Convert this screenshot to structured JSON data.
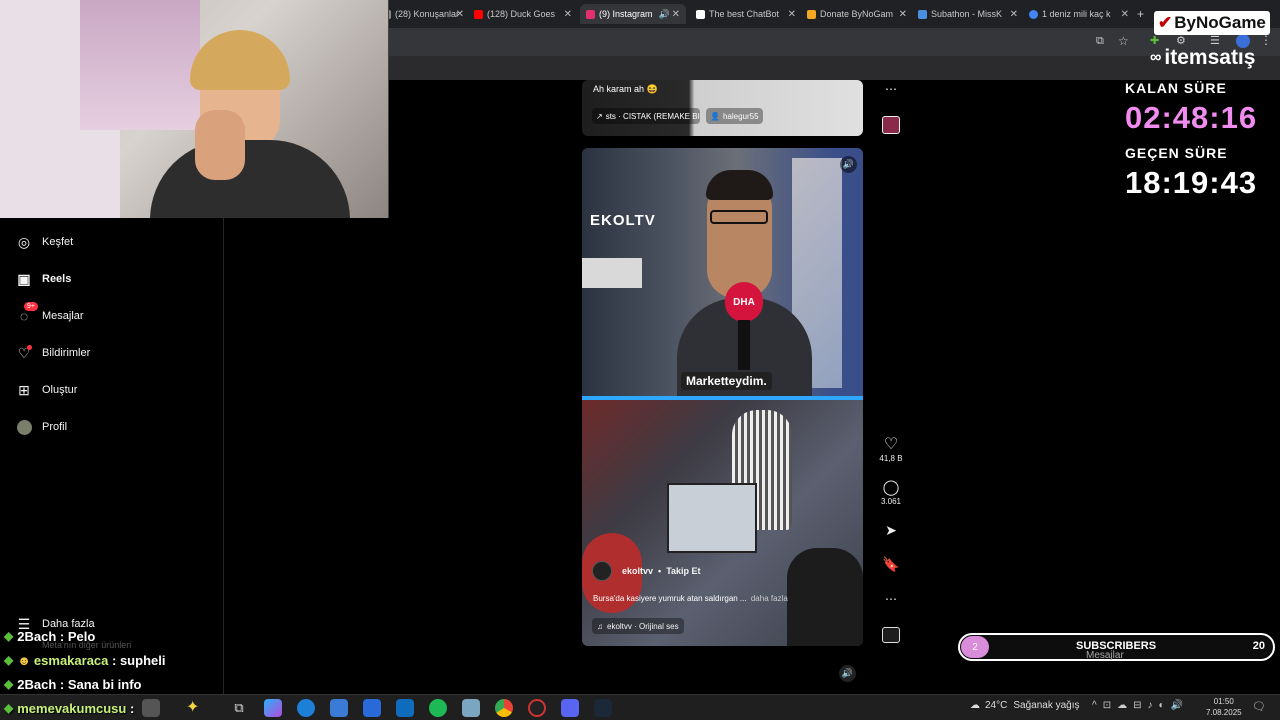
{
  "browser": {
    "tabs": [
      {
        "label": "(28) Konuşanlar",
        "color": "#888888"
      },
      {
        "label": "(128) Duck Goes",
        "color": "#ff0000"
      },
      {
        "label": "(9) Instagram",
        "color": "#e1306c",
        "active": true
      },
      {
        "label": "The best ChatBot",
        "color": "#ffffff"
      },
      {
        "label": "Donate ByNoGam",
        "color": "#f5a623"
      },
      {
        "label": "Subathon - MissK",
        "color": "#4a90e2"
      },
      {
        "label": "1 deniz mili kaç k",
        "color": "#4285f4"
      }
    ],
    "new_tab": "+"
  },
  "sidebar": {
    "items": [
      {
        "label": "Keşfet",
        "icon": "compass-icon",
        "glyph": "◎"
      },
      {
        "label": "Reels",
        "icon": "reels-icon",
        "glyph": "▣",
        "bold": true
      },
      {
        "label": "Mesajlar",
        "icon": "messenger-icon",
        "glyph": "◌",
        "badge": "9+"
      },
      {
        "label": "Bildirimler",
        "icon": "heart-icon",
        "glyph": "♡"
      },
      {
        "label": "Oluştur",
        "icon": "plus-square-icon",
        "glyph": "⊞"
      },
      {
        "label": "Profil",
        "icon": "avatar-icon",
        "glyph": "●"
      }
    ],
    "more_label": "Daha fazla",
    "more_icon": "menu-icon",
    "also_from_meta": "Meta'nın diğer ürünleri"
  },
  "reel_top": {
    "caption": "Ah karam ah 😆",
    "audio": "sts · CISTAK (REMAKE BI",
    "user": "halegur55"
  },
  "reel_main": {
    "channel_logo": "EKOLTV",
    "mic_label": "DHA",
    "subtitle": "Marketteydim.",
    "username": "ekoltvv",
    "dot": "•",
    "follow": "Takip Et",
    "caption": "Bursa'da kasiyere yumruk atan saldırgan ...",
    "more": "daha fazla",
    "audio": "ekoltvv · Orijinal ses",
    "likes": "41,8 B",
    "comments": "3.061"
  },
  "overlay": {
    "brand1": "ByNoGame",
    "brand2": "itemsatış",
    "remaining_label": "KALAN SÜRE",
    "remaining_value": "02:48:16",
    "elapsed_label": "GEÇEN SÜRE",
    "elapsed_value": "18:19:43",
    "remaining_color": "#f08cf0",
    "subs_label": "SUBSCRIBERS",
    "subs_left": "2",
    "subs_right": "20",
    "messages_label": "Mesajlar"
  },
  "chat": [
    {
      "user": "2Bach",
      "sep": " : ",
      "msg": "Pelo",
      "user_color": "#ffffff"
    },
    {
      "user": "esmakaraca",
      "sep": " : ",
      "msg": "supheli",
      "user_color": "#c8f07a",
      "emote": true
    },
    {
      "user": "2Bach",
      "sep": " : ",
      "msg": "Sana bi info",
      "user_color": "#ffffff"
    },
    {
      "user": "memevakumcusu",
      "sep": " : ",
      "msg": "",
      "user_color": "#c8f07a"
    }
  ],
  "taskbar": {
    "weather_temp": "24°C",
    "weather_desc": "Sağanak yağış",
    "time": "01:50",
    "date": "7.08.2025"
  }
}
